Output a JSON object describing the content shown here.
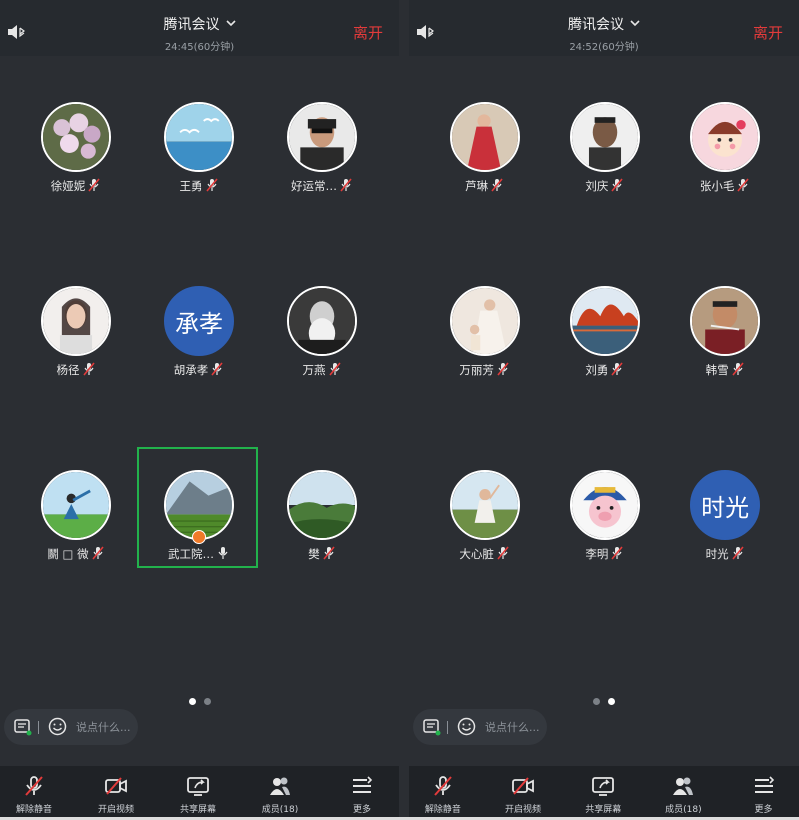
{
  "screens": [
    {
      "title": "腾讯会议",
      "timer": "24:45(60分钟)",
      "leave_label": "离开",
      "participants": [
        {
          "name": "徐娅妮",
          "avatar": "photo-flowers",
          "muted": true
        },
        {
          "name": "王勇",
          "avatar": "photo-seagulls",
          "muted": true
        },
        {
          "name": "好运常…",
          "avatar": "photo-man-glasses",
          "muted": true
        },
        {
          "name": "杨径",
          "avatar": "photo-woman",
          "muted": true
        },
        {
          "name": "胡承孝",
          "avatar_text": "承孝",
          "muted": true
        },
        {
          "name": "万燕",
          "avatar": "photo-old-man",
          "muted": true
        },
        {
          "name": "鬭 □ 微",
          "avatar": "photo-yoga",
          "muted": true
        },
        {
          "name": "武工院…",
          "avatar": "photo-mountain-tea",
          "muted": false,
          "speaking": true
        },
        {
          "name": "樊",
          "avatar": "photo-green-hills",
          "muted": true
        }
      ],
      "page_index": 0,
      "chat_placeholder": "说点什么..."
    },
    {
      "title": "腾讯会议",
      "timer": "24:52(60分钟)",
      "leave_label": "离开",
      "participants": [
        {
          "name": "芦琳",
          "avatar": "photo-red-dress",
          "muted": true
        },
        {
          "name": "刘庆",
          "avatar": "photo-man-bw",
          "muted": true
        },
        {
          "name": "张小毛",
          "avatar": "cartoon-girl",
          "muted": true
        },
        {
          "name": "万丽芳",
          "avatar": "photo-wedding",
          "muted": true
        },
        {
          "name": "刘勇",
          "avatar": "photo-autumn-lake",
          "muted": true
        },
        {
          "name": "韩雪",
          "avatar": "photo-man-eating",
          "muted": true
        },
        {
          "name": "大心脏",
          "avatar": "photo-child-field",
          "muted": true
        },
        {
          "name": "李明",
          "avatar": "cartoon-pig",
          "muted": true
        },
        {
          "name": "时光",
          "avatar_text": "时光",
          "muted": true
        }
      ],
      "page_index": 1,
      "chat_placeholder": "说点什么..."
    }
  ],
  "toolbar": [
    {
      "label": "解除静音",
      "icon": "mic-muted-icon"
    },
    {
      "label": "开启视频",
      "icon": "camera-off-icon"
    },
    {
      "label": "共享屏幕",
      "icon": "share-screen-icon"
    },
    {
      "label": "成员(18)",
      "icon": "members-icon"
    },
    {
      "label": "更多",
      "icon": "more-icon"
    }
  ],
  "colors": {
    "background": "#2b2e33",
    "leave": "#e23b3b",
    "active_border": "#22b24c",
    "avatar_text_bg": "#2f5fb3"
  }
}
